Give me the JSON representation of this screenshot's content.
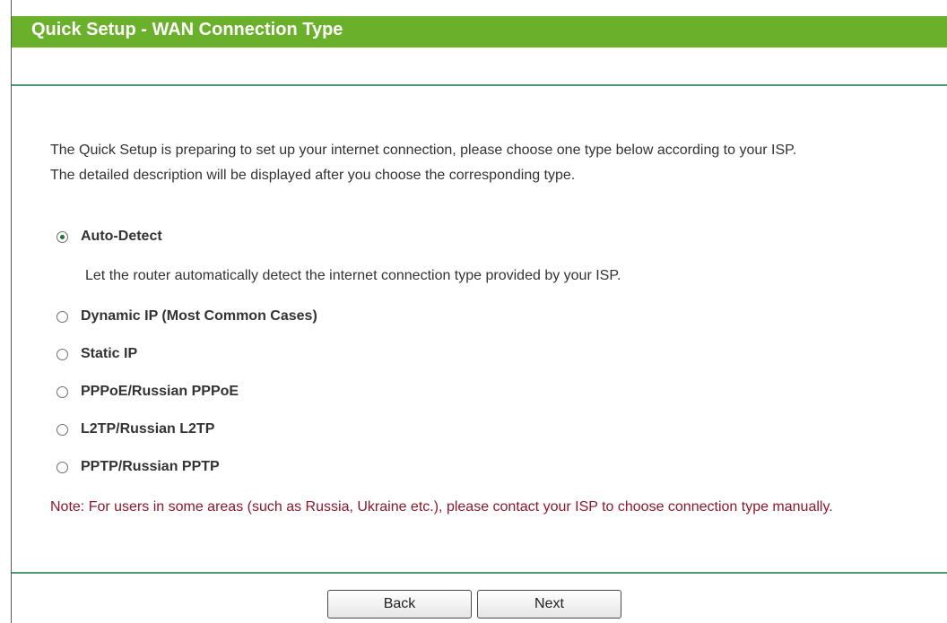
{
  "header": {
    "title": "Quick Setup - WAN Connection Type"
  },
  "intro": {
    "line1": "The Quick Setup is preparing to set up your internet connection, please choose one type below according to your ISP.",
    "line2": "The detailed description will be displayed after you choose the corresponding type."
  },
  "options": [
    {
      "label": "Auto-Detect",
      "checked": true,
      "description": "Let the router automatically detect the internet connection type provided by your ISP."
    },
    {
      "label": "Dynamic IP (Most Common Cases)",
      "checked": false
    },
    {
      "label": "Static IP",
      "checked": false
    },
    {
      "label": "PPPoE/Russian PPPoE",
      "checked": false
    },
    {
      "label": "L2TP/Russian L2TP",
      "checked": false
    },
    {
      "label": "PPTP/Russian PPTP",
      "checked": false
    }
  ],
  "note": "Note: For users in some areas (such as Russia, Ukraine etc.), please contact your ISP to choose connection type manually.",
  "buttons": {
    "back_label": "Back",
    "next_label": "Next"
  },
  "colors": {
    "title_bar": "#6ab02a",
    "divider": "#4d9a74",
    "note_text": "#8b1a2e"
  }
}
